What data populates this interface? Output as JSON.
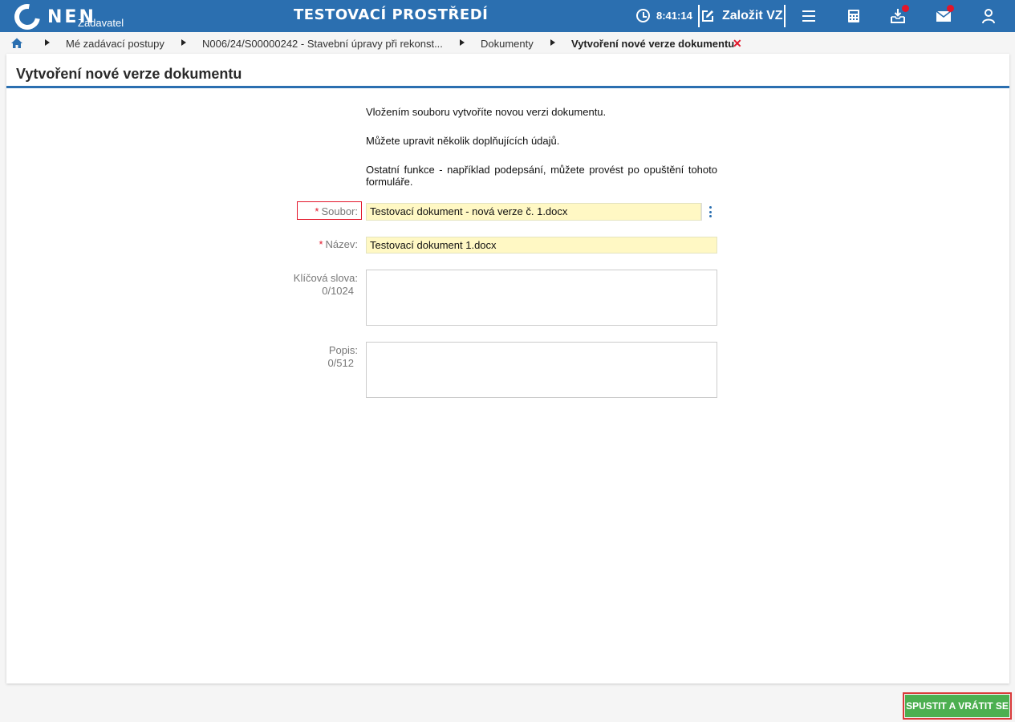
{
  "header": {
    "logo_text": "NEN",
    "role": "Zadavatel",
    "environment": "TESTOVACÍ PROSTŘEDÍ",
    "time": "8:41:14",
    "create_label": "Založit VZ",
    "icons": [
      "clock-icon",
      "edit-icon",
      "menu-icon",
      "calculator-icon",
      "inbox-download-icon",
      "mail-icon",
      "user-icon"
    ],
    "badge_color": "#e3162a",
    "brand_color": "#2b6fb0"
  },
  "breadcrumb": {
    "items": [
      "Mé zadávací postupy",
      "N006/24/S00000242 - Stavební úpravy při rekonst...",
      "Dokumenty",
      "Vytvoření nové verze dokumentu"
    ],
    "close": "✕"
  },
  "panel": {
    "title": "Vytvoření nové verze dokumentu",
    "info": [
      "Vložením souboru vytvoříte novou verzi dokumentu.",
      "Můžete upravit několik doplňujících údajů.",
      "Ostatní funkce - například podepsání, můžete provést po opuštění tohoto formuláře."
    ]
  },
  "form": {
    "file": {
      "required_mark": "*",
      "label": "Soubor:",
      "value": "Testovací dokument - nová verze č. 1.docx"
    },
    "name": {
      "required_mark": "*",
      "label": "Název:",
      "value": "Testovací dokument 1.docx"
    },
    "keywords": {
      "label": "Klíčová slova:",
      "counter": "0/1024",
      "value": ""
    },
    "description": {
      "label": "Popis:",
      "counter": "0/512",
      "value": ""
    }
  },
  "actions": {
    "run_label": "SPUSTIT A VRÁTIT SE",
    "run_color": "#4caf50"
  }
}
